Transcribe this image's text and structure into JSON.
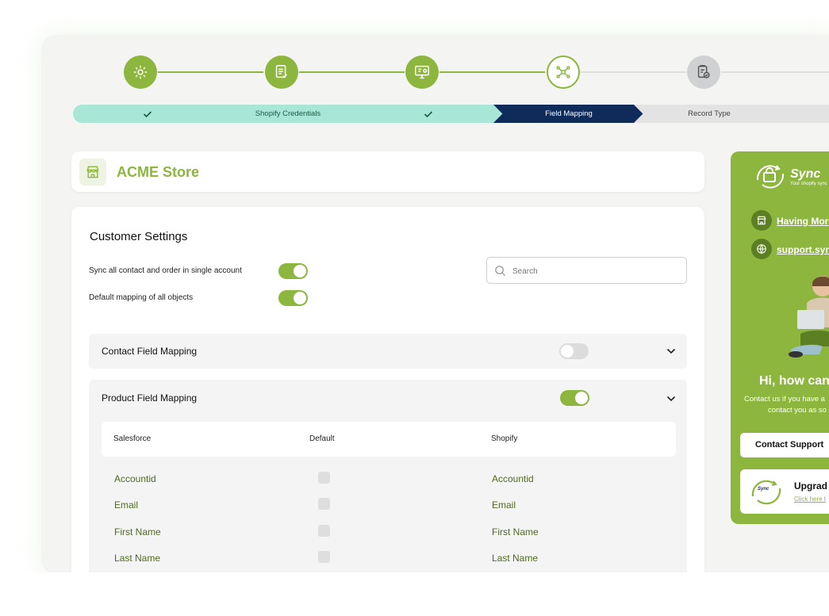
{
  "stepper": {
    "steps": [
      {
        "label": "",
        "state": "done",
        "icon": "gear-settings-icon"
      },
      {
        "label": "Shopify Credentials",
        "state": "done",
        "icon": "document-icon"
      },
      {
        "label": "",
        "state": "done",
        "icon": "monitor-icon"
      },
      {
        "label": "Field Mapping",
        "state": "active",
        "icon": "network-nodes-icon"
      },
      {
        "label": "Record Type",
        "state": "todo",
        "icon": "clipboard-check-icon"
      }
    ]
  },
  "store": {
    "name": "ACME Store"
  },
  "customer_settings": {
    "title": "Customer Settings",
    "sync_all_label": "Sync all contact and order in single account",
    "sync_all_on": true,
    "default_mapping_label": "Default mapping of all objects",
    "default_mapping_on": true,
    "search_placeholder": "Search"
  },
  "contact_mapping": {
    "title": "Contact Field Mapping",
    "enabled": false
  },
  "product_mapping": {
    "title": "Product Field Mapping",
    "enabled": true,
    "columns": [
      "Salesforce",
      "Default",
      "Shopify"
    ],
    "rows": [
      {
        "salesforce": "Accountid",
        "shopify": "Accountid"
      },
      {
        "salesforce": "Email",
        "shopify": "Email"
      },
      {
        "salesforce": "First Name",
        "shopify": "First Name"
      },
      {
        "salesforce": "Last Name",
        "shopify": "Last Name"
      }
    ]
  },
  "sidebar": {
    "brand": "Sync",
    "tagline": "Your shopify sync",
    "link_having_more": "Having More",
    "link_support": "support.sync",
    "heading": "Hi, how can",
    "contact_text_line1": "Contact us if you have a",
    "contact_text_line2": "contact you as so",
    "contact_button": "Contact Support",
    "upgrade_title": "Upgrad",
    "upgrade_link": "Click here t",
    "upgrade_logo_text": "Sync"
  },
  "colors": {
    "accent_green": "#8cb63e",
    "dark_navy": "#0f2b5a",
    "mint": "#a8e6d6",
    "text_green": "#4f6b1e"
  }
}
